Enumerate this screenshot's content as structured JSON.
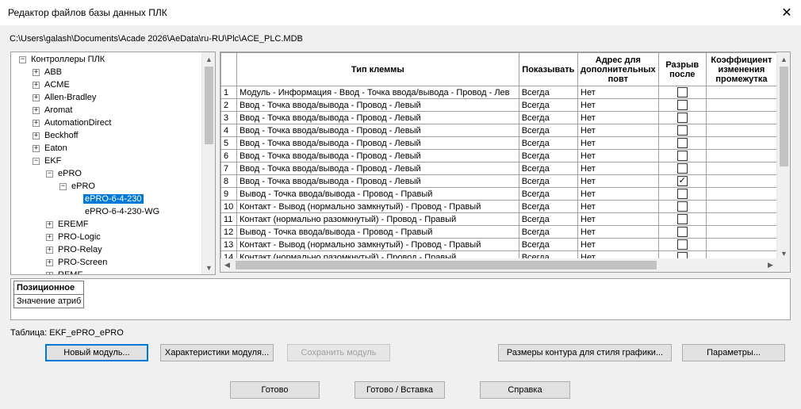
{
  "window": {
    "title": "Редактор файлов базы данных ПЛК",
    "close_glyph": "✕",
    "path": "C:\\Users\\galash\\Documents\\Acade 2026\\AeData\\ru-RU\\Plc\\ACE_PLC.MDB"
  },
  "tree": {
    "root": "Контроллеры ПЛК",
    "manufacturers": [
      "ABB",
      "ACME",
      "Allen-Bradley",
      "Aromat",
      "AutomationDirect",
      "Beckhoff",
      "Eaton",
      "EKF"
    ],
    "ekf_family": "ePRO",
    "ekf_series": "ePRO",
    "ekf_models": [
      "ePRO-6-4-230",
      "ePRO-6-4-230-WG"
    ],
    "ekf_more": [
      "EREMF",
      "PRO-Logic",
      "PRO-Relay",
      "PRO-Screen",
      "REMF"
    ],
    "expand_glyph": "+",
    "collapse_glyph": "−"
  },
  "grid": {
    "columns": [
      "Тип клеммы",
      "Показывать",
      "Адрес для дополнительных повт",
      "Разрыв после",
      "Коэффициент изменения промежутка"
    ],
    "rows": [
      {
        "num": "1",
        "type": "Модуль - Информация - Ввод - Точка ввода/вывода - Провод - Лев",
        "show": "Всегда",
        "addr": "Нет",
        "checked": false
      },
      {
        "num": "2",
        "type": "Ввод - Точка ввода/вывода - Провод - Левый",
        "show": "Всегда",
        "addr": "Нет",
        "checked": false
      },
      {
        "num": "3",
        "type": "Ввод - Точка ввода/вывода - Провод - Левый",
        "show": "Всегда",
        "addr": "Нет",
        "checked": false
      },
      {
        "num": "4",
        "type": "Ввод - Точка ввода/вывода - Провод - Левый",
        "show": "Всегда",
        "addr": "Нет",
        "checked": false
      },
      {
        "num": "5",
        "type": "Ввод - Точка ввода/вывода - Провод - Левый",
        "show": "Всегда",
        "addr": "Нет",
        "checked": false
      },
      {
        "num": "6",
        "type": "Ввод - Точка ввода/вывода - Провод - Левый",
        "show": "Всегда",
        "addr": "Нет",
        "checked": false
      },
      {
        "num": "7",
        "type": "Ввод - Точка ввода/вывода - Провод - Левый",
        "show": "Всегда",
        "addr": "Нет",
        "checked": false
      },
      {
        "num": "8",
        "type": "Ввод - Точка ввода/вывода - Провод - Левый",
        "show": "Всегда",
        "addr": "Нет",
        "checked": true
      },
      {
        "num": "9",
        "type": "Вывод - Точка ввода/вывода - Провод - Правый",
        "show": "Всегда",
        "addr": "Нет",
        "checked": false
      },
      {
        "num": "10",
        "type": "Контакт - Вывод (нормально замкнутый) - Провод - Правый",
        "show": "Всегда",
        "addr": "Нет",
        "checked": false
      },
      {
        "num": "11",
        "type": "Контакт (нормально разомкнутый) - Провод - Правый",
        "show": "Всегда",
        "addr": "Нет",
        "checked": false
      },
      {
        "num": "12",
        "type": "Вывод - Точка ввода/вывода - Провод - Правый",
        "show": "Всегда",
        "addr": "Нет",
        "checked": false
      },
      {
        "num": "13",
        "type": "Контакт - Вывод (нормально замкнутый) - Провод - Правый",
        "show": "Всегда",
        "addr": "Нет",
        "checked": false
      },
      {
        "num": "14",
        "type": "Контакт (нормально разомкнутый) - Провод - Правый",
        "show": "Всегда",
        "addr": "Нет",
        "checked": false
      }
    ]
  },
  "props": {
    "header": "Позиционное",
    "value": "Значение атриб"
  },
  "table_label": "Таблица: EKF_ePRO_ePRO",
  "buttons": {
    "new_module": "Новый модуль...",
    "module_props": "Характеристики модуля...",
    "save_module": "Сохранить модуль",
    "contour": "Размеры контура для стиля графики...",
    "params": "Параметры...",
    "done": "Готово",
    "done_insert": "Готово / Вставка",
    "help": "Справка"
  },
  "colors": {
    "selection": "#0078d7",
    "window_bg": "#f0f0f0"
  }
}
